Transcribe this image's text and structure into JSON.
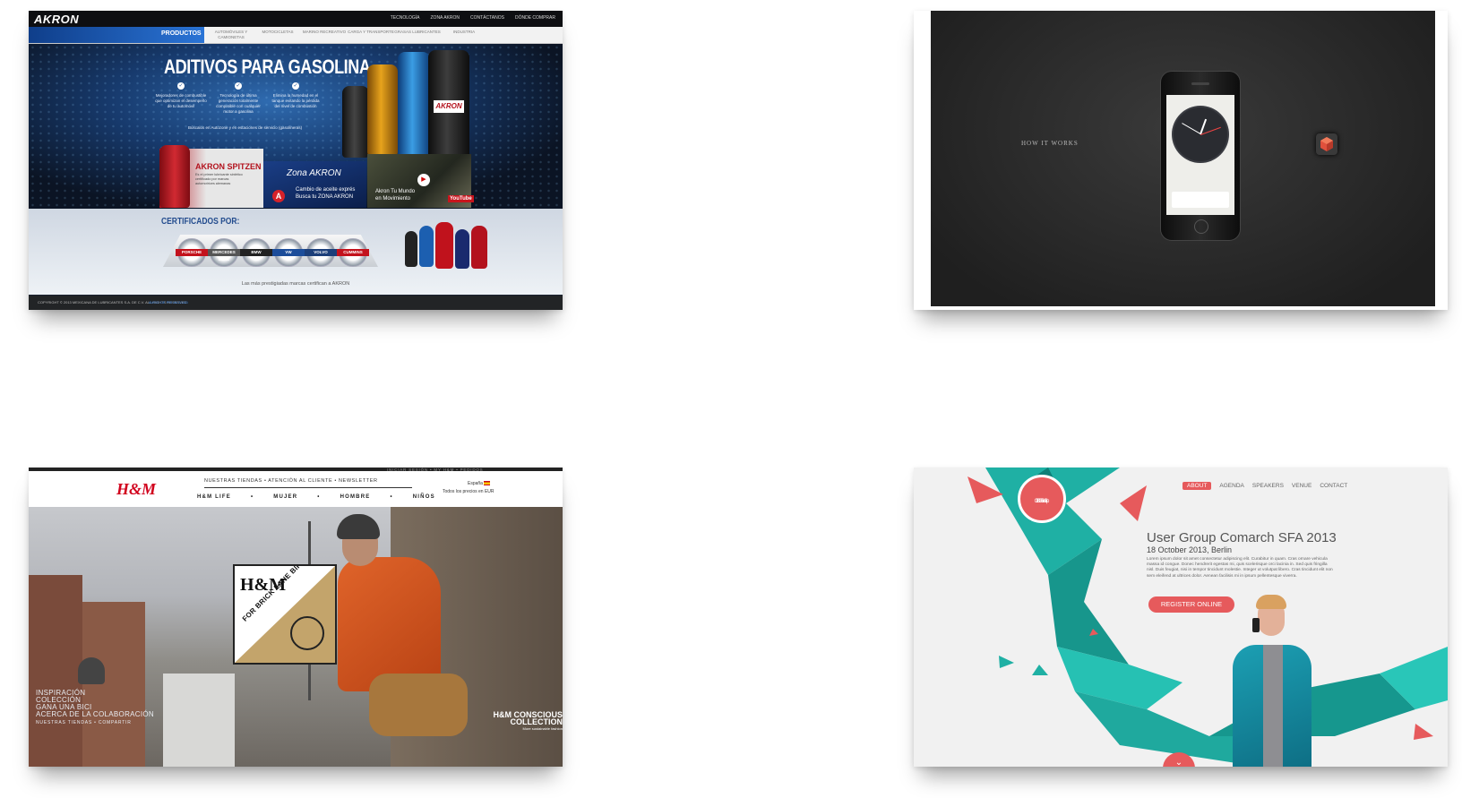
{
  "akron": {
    "logo": "AKRON",
    "top_links": [
      "TECNOLOGÍA",
      "ZONA AKRON",
      "CONTÁCTANOS",
      "DÓNDE COMPRAR"
    ],
    "nav_active": "PRODUCTOS",
    "nav_items": [
      "AUTOMÓVILES Y CAMIONETAS",
      "MOTOCICLETAS",
      "MARINO RECREATIVO",
      "CARGA Y TRANSPORTE",
      "GRASAS LUBRICANTES",
      "INDUSTRIA"
    ],
    "hero_title": "ADITIVOS PARA GASOLINA",
    "features": [
      "Mejoradores de combustible que optimizan el desempeño de tu automóvil",
      "Tecnología de última generación totalmente compatible con cualquier motor a gasolina",
      "Elimina la humedad y evita que el filtro se tape",
      "Elimina la humedad en el tanque evitando la pérdida del nivel de combustión"
    ],
    "note": "Búscalos en Autozone y en estaciones de servicio (gasolineras)",
    "spitzen_title": "AKRON SPITZEN",
    "spitzen_desc": "Es el primer lubricante sintético certificado por marcas automotrices alemanas",
    "zona_label": "Zona AKRON",
    "zona_text": [
      "Cambio de aceite exprés",
      "Busca tu ZONA AKRON"
    ],
    "video_text": [
      "Akron Tu Mundo",
      "en Movimiento"
    ],
    "youtube": "YouTube",
    "cert_title": "CERTIFICADOS POR:",
    "cert_badges": [
      "PORSCHE",
      "MERCEDES BENZ",
      "BMW",
      "VW",
      "VOLVO",
      "CUMMINS"
    ],
    "brands_line": "Las más prestigiadas marcas certifican a AKRON",
    "copyright": "COPYRIGHT © 2013 MEXICANA DE LUBRICANTES S.A. DE C.V. ALL RIGHTS RESERVED.",
    "privacy": "AVISO DE PRIVACIDAD"
  },
  "app": {
    "how": "HOW IT WORKS"
  },
  "hm": {
    "logo": "H&M",
    "meta": "INICIAR SESIÓN  •  MY H&M  •  PEDIDOS",
    "top_links": "NUESTRAS TIENDAS  •  ATENCIÓN AL CLIENTE  •  NEWSLETTER",
    "main_nav": [
      "H&M LIFE",
      "•",
      "MUJER",
      "•",
      "HOMBRE",
      "•",
      "NIÑOS"
    ],
    "lang": "España",
    "price_note": "Todos los precios en EUR",
    "sign_logo": "H&M",
    "sign_for": "FOR BRICK LANE BIKES",
    "overlay_links": [
      "INSPIRACIÓN",
      "COLECCIÓN",
      "GANA UNA BICI",
      "ACERCA DE LA COLABORACIÓN"
    ],
    "overlay_small": "NUESTRAS TIENDAS • COMPARTIR",
    "conscious_title": "H&M CONSCIOUS COLLECTION",
    "conscious_sub": "More sustainable fashion"
  },
  "sfa": {
    "badge": [
      "User",
      "Group",
      "SFA",
      "2013"
    ],
    "nav": [
      "ABOUT",
      "AGENDA",
      "SPEAKERS",
      "VENUE",
      "CONTACT"
    ],
    "title": "User Group Comarch SFA 2013",
    "date": "18 October 2013, Berlin",
    "text": "Lorem ipsum dolor sit amet consectetur adipiscing elit. Curabitur in quam. Cras ornare vehicula massa id congue. Donec hendrerit egestas mi, quis scelerisque orci lacinia in. Sed quis fringilla nisl. Duis feugiat, nisi in tempor tincidunt molestie. Integer ut volutpat libero. Cras tincidunt elit non sem eleifend at ultrices dolor. Aenean facilisis mi in ipsum pellentesque viverra.",
    "register": "REGISTER ONLINE",
    "down": "⌄"
  },
  "colors": {
    "akron_blue": "#2a74d6",
    "hm_red": "#d1001c",
    "sfa_teal": "#1fb0a4",
    "sfa_coral": "#e65a5c"
  }
}
